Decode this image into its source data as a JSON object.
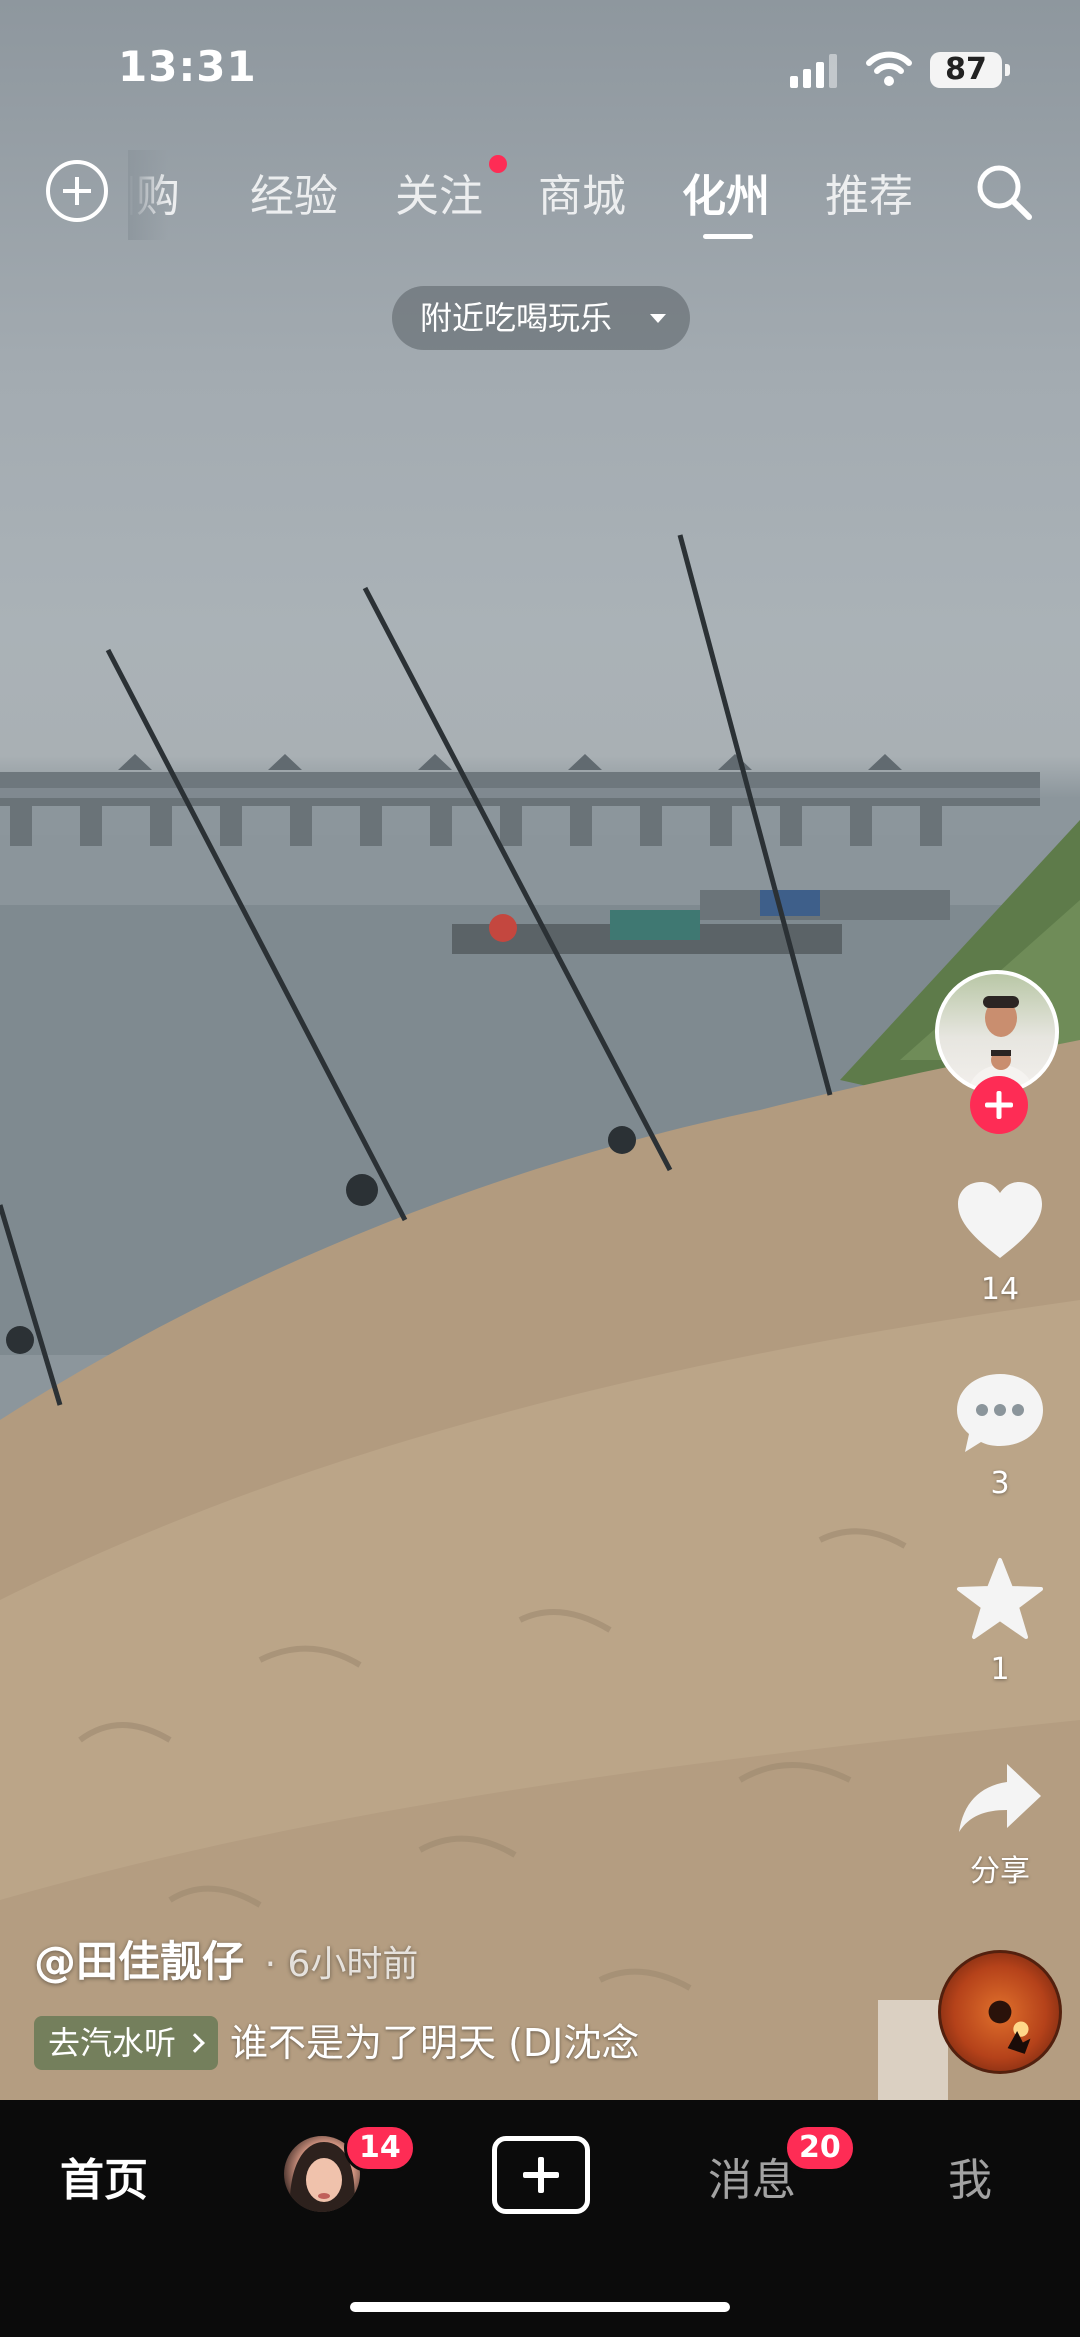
{
  "status_bar": {
    "time": "13:31",
    "battery": "87",
    "signal_icon": "cellular-signal-icon",
    "wifi_icon": "wifi-icon"
  },
  "top_nav": {
    "tabs": [
      {
        "label": "团购",
        "active": false
      },
      {
        "label": "经验",
        "active": false
      },
      {
        "label": "关注",
        "active": false,
        "has_dot": true
      },
      {
        "label": "商城",
        "active": false
      },
      {
        "label": "化州",
        "active": true
      },
      {
        "label": "推荐",
        "active": false
      }
    ],
    "add_icon": "add-circle-icon",
    "search_icon": "search-icon",
    "nearby_filter": "附近吃喝玩乐"
  },
  "right_rail": {
    "like_count": "14",
    "comment_count": "3",
    "favorite_count": "1",
    "share_label": "分享"
  },
  "caption": {
    "author": "@田佳靓仔",
    "time_ago": "· 6小时前",
    "listen_chip": "去汽水听",
    "song_title": "谁不是为了明天 (DJ沈念"
  },
  "bottom_bar": {
    "home": "首页",
    "friends_badge": "14",
    "messages": "消息",
    "messages_badge": "20",
    "me": "我"
  },
  "colors": {
    "accent": "#fe2c55",
    "bottom_bar_bg": "#0b0b0b"
  }
}
